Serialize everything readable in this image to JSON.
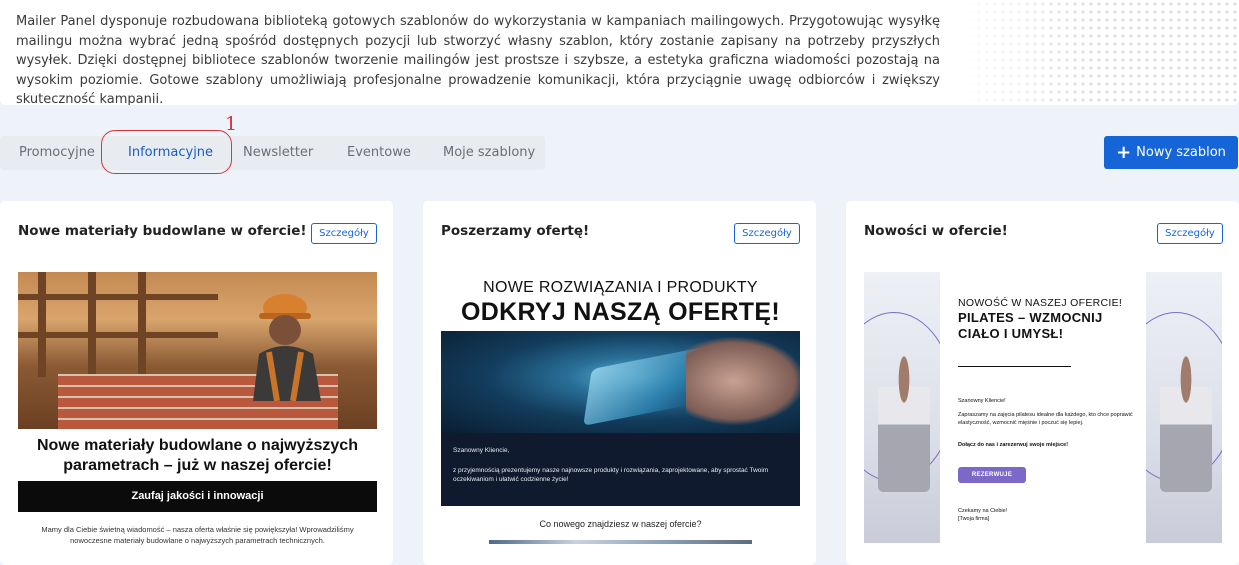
{
  "intro": {
    "text": "Mailer Panel dysponuje rozbudowana biblioteką gotowych szablonów do wykorzystania w kampaniach mailingowych. Przygotowując wysyłkę mailingu można wybrać jedną spośród dostępnych pozycji lub stworzyć własny szablon, który zostanie zapisany na potrzeby przyszłych wysyłek. Dzięki dostępnej bibliotece szablonów tworzenie mailingów jest prostsze i szybsze, a estetyka graficzna wiadomości pozostają na wysokim poziomie. Gotowe szablony umożliwiają profesjonalne prowadzenie komunikacji, która przyciągnie uwagę odbiorców i zwiększy skuteczność kampanii."
  },
  "tabs": [
    {
      "label": "Promocyjne",
      "active": false
    },
    {
      "label": "Informacyjne",
      "active": true
    },
    {
      "label": "Newsletter",
      "active": false
    },
    {
      "label": "Eventowe",
      "active": false
    },
    {
      "label": "Moje szablony",
      "active": false
    }
  ],
  "annotation": {
    "number": "1",
    "color": "#d9333f"
  },
  "new_template_button": {
    "label": "Nowy szablon",
    "icon": "plus-icon"
  },
  "colors": {
    "accent": "#1565d8",
    "background": "#eef3fa"
  },
  "cards": [
    {
      "title": "Nowe materiały budowlane w ofercie!",
      "details_label": "Szczegóły",
      "preview": {
        "heading": "Nowe materiały budowlane o najwyższych parametrach – już w naszej ofercie!",
        "bar_text": "Zaufaj jakości i innowacji",
        "body": "Mamy dla Ciebie świetną wiadomość – nasza oferta właśnie się powiększyła! Wprowadziliśmy nowoczesne materiały budowlane o najwyższych parametrach technicznych."
      }
    },
    {
      "title": "Poszerzamy ofertę!",
      "details_label": "Szczegóły",
      "preview": {
        "subheading": "NOWE ROZWIĄZANIA I PRODUKTY",
        "heading": "ODKRYJ NASZĄ OFERTĘ!",
        "greeting": "Szanowny Kliencie,",
        "body": "z przyjemnością prezentujemy nasze najnowsze produkty i rozwiązania, zaprojektowane, aby sprostać Twoim oczekiwaniom i ułatwić codzienne życie!",
        "question": "Co nowego znajdziesz w naszej ofercie?"
      }
    },
    {
      "title": "Nowości w ofercie!",
      "details_label": "Szczegóły",
      "preview": {
        "subheading": "NOWOŚĆ W NASZEJ OFERCIE!",
        "heading": "PILATES – WZMOCNIJ CIAŁO I UMYSŁ!",
        "greeting": "Szanowny Kliencie!",
        "body": "Zapraszamy na zajęcia pilatesu idealne dla każdego, kto chce poprawić elastyczność, wzmocnić mięśnie i poczuć się lepiej.",
        "cta_text": "Dołącz do nas i zarezerwuj swoje miejsce!",
        "button_label": "REZERWUJE",
        "closing_1": "Czekamy na Ciebie!",
        "closing_2": "[Twoja firma]"
      }
    }
  ]
}
